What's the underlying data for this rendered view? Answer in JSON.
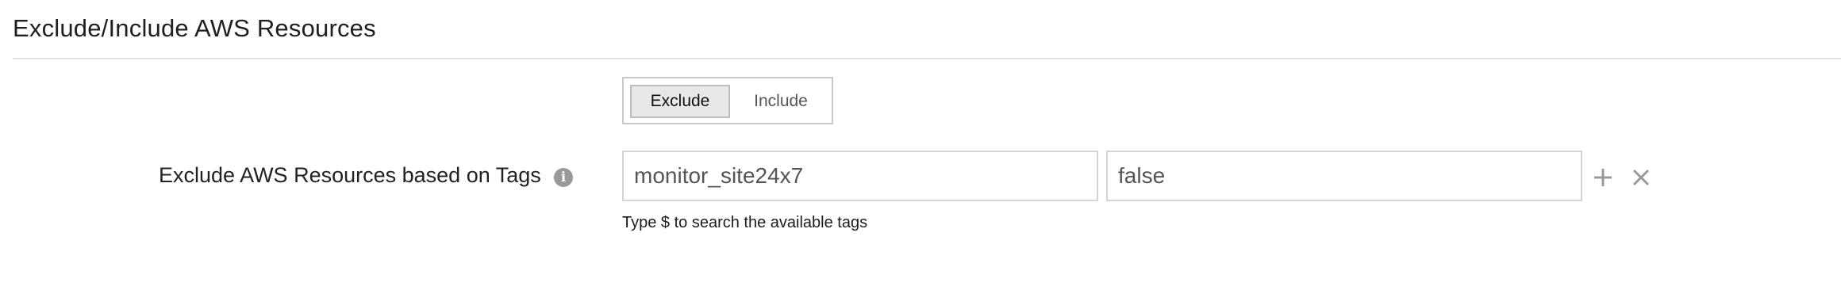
{
  "section": {
    "title": "Exclude/Include AWS Resources"
  },
  "mode_toggle": {
    "options": [
      {
        "label": "Exclude",
        "selected": true
      },
      {
        "label": "Include",
        "selected": false
      }
    ]
  },
  "tag_filter": {
    "label": "Exclude AWS Resources based on Tags",
    "info_icon": "info-icon",
    "info_glyph": "i",
    "key_value": "monitor_site24x7",
    "value_value": "false",
    "add_icon": "plus-icon",
    "remove_icon": "close-icon",
    "hint": "Type $ to search the available tags"
  },
  "colors": {
    "selected_bg": "#e8e8e8",
    "border": "#d4d4d4",
    "icon": "#999999",
    "divider": "#e1e1e1"
  }
}
